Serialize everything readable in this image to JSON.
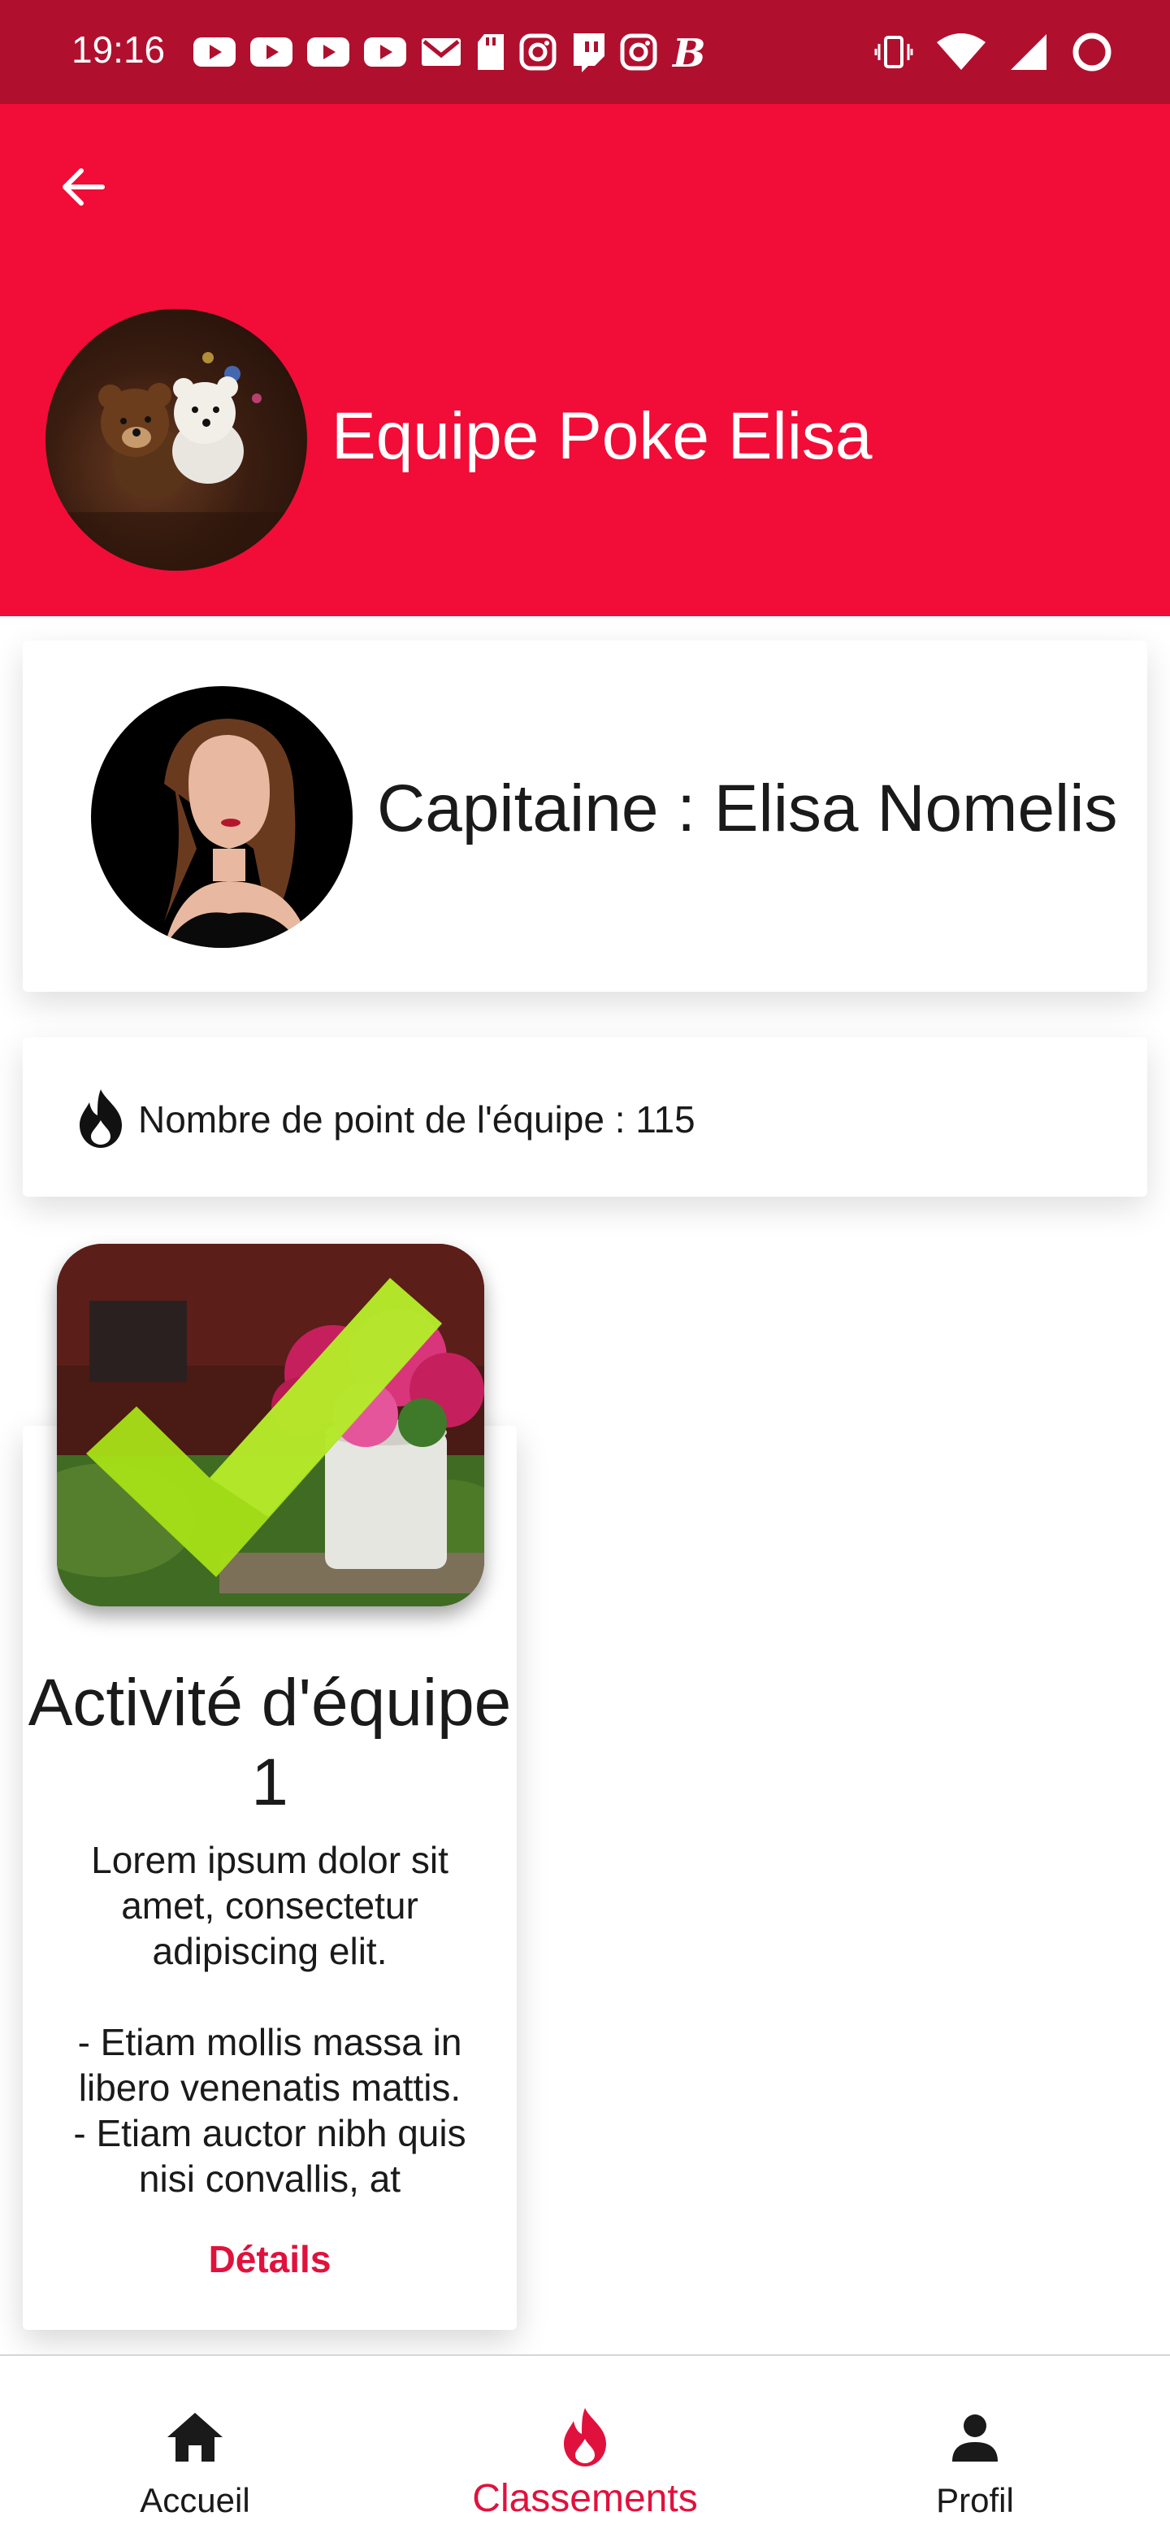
{
  "status_bar": {
    "time": "19:16",
    "icons_left": [
      "youtube-icon",
      "youtube-icon",
      "youtube-icon",
      "youtube-icon",
      "gmail-icon",
      "sd-card-icon",
      "instagram-icon",
      "twitch-icon",
      "instagram-icon",
      "b-app-icon"
    ],
    "icons_right": [
      "vibrate-icon",
      "wifi-icon",
      "signal-icon",
      "battery-ring-icon"
    ]
  },
  "header": {
    "back_icon": "arrow-left-icon",
    "team_name": "Equipe Poke Elisa",
    "background": "#f10d37"
  },
  "captain": {
    "text": "Capitaine : Elisa Nomelis"
  },
  "points": {
    "icon": "flame-icon",
    "text": "Nombre de point de l'équipe : 115"
  },
  "activity": {
    "title": "Activité d'équipe 1",
    "description": "Lorem ipsum dolor sit amet, consectetur adipiscing elit.\n\n- Etiam mollis massa in libero venenatis mattis.\n- Etiam auctor nibh quis nisi convallis, at",
    "details_label": "Détails",
    "completed_icon": "checkmark-icon"
  },
  "bottom_nav": {
    "items": [
      {
        "label": "Accueil",
        "icon": "home-icon",
        "active": false
      },
      {
        "label": "Classements",
        "icon": "flame-icon",
        "active": true
      },
      {
        "label": "Profil",
        "icon": "person-icon",
        "active": false
      }
    ]
  },
  "colors": {
    "accent": "#e0123d",
    "status_bar": "#b0102e",
    "header": "#f10d37",
    "check_green": "#a6e016"
  }
}
